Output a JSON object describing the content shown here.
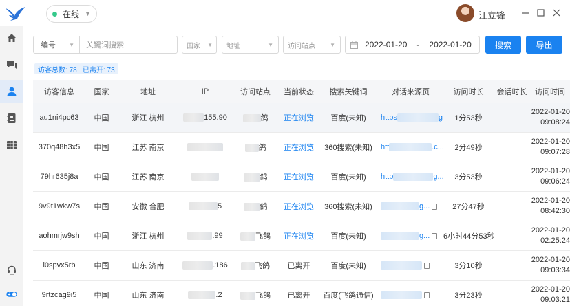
{
  "topbar": {
    "status_label": "在线",
    "user_name": "江立锋",
    "status_color": "#36c98b"
  },
  "sidebar": {
    "items": [
      {
        "icon": "home-icon",
        "active": false
      },
      {
        "icon": "chat-icon",
        "active": false
      },
      {
        "icon": "user-icon",
        "active": true
      },
      {
        "icon": "contacts-icon",
        "active": false
      },
      {
        "icon": "grid-icon",
        "active": false
      }
    ],
    "bottom": [
      {
        "icon": "support-icon"
      },
      {
        "icon": "toggle-icon"
      }
    ]
  },
  "filters": {
    "field_select": "编号",
    "keyword_placeholder": "关键词搜索",
    "country_placeholder": "国家",
    "address_placeholder": "地址",
    "site_placeholder": "访问站点",
    "date_start": "2022-01-20",
    "date_sep": "-",
    "date_end": "2022-01-20",
    "search_label": "搜索",
    "export_label": "导出"
  },
  "stats": {
    "total_visitors": "访客总数: 78",
    "left_count": "已离开: 73"
  },
  "table": {
    "headers": [
      "访客信息",
      "国家",
      "地址",
      "IP",
      "访问站点",
      "当前状态",
      "搜索关键词",
      "对话来源页",
      "访问时长",
      "会话时长",
      "访问时间"
    ],
    "rows": [
      {
        "id": "au1ni4pc63",
        "country": "中国",
        "address": "浙江 杭州",
        "ip": "155.90",
        "site": "鸽",
        "status": "正在浏览",
        "keyword": "百度(未知)",
        "source": "https",
        "source_end": "g...",
        "duration": "1分53秒",
        "session": "",
        "time": "2022-01-20 09:08:24"
      },
      {
        "id": "370q48h3x5",
        "country": "中国",
        "address": "江苏 南京",
        "ip": "",
        "site": "鸽",
        "status": "正在浏览",
        "keyword": "360搜索(未知)",
        "source": "htt",
        "source_end": ".c...",
        "duration": "2分49秒",
        "session": "",
        "time": "2022-01-20 09:07:28"
      },
      {
        "id": "79hr635j8a",
        "country": "中国",
        "address": "江苏 南京",
        "ip": "",
        "site": "鸽",
        "status": "正在浏览",
        "keyword": "百度(未知)",
        "source": "http",
        "source_end": "g...",
        "duration": "3分53秒",
        "session": "",
        "time": "2022-01-20 09:06:24"
      },
      {
        "id": "9v9t1wkw7s",
        "country": "中国",
        "address": "安徽 合肥",
        "ip": "5",
        "site": "鸽",
        "status": "正在浏览",
        "keyword": "360搜索(未知)",
        "source": "",
        "source_end": "g...",
        "duration": "27分47秒",
        "session": "",
        "time": "2022-01-20 08:42:30"
      },
      {
        "id": "aohmrjw9sh",
        "country": "中国",
        "address": "浙江 杭州",
        "ip": ".99",
        "site": "飞鸽",
        "status": "正在浏览",
        "keyword": "百度(未知)",
        "source": "",
        "source_end": "g...",
        "duration": "6小时44分53秒",
        "session": "",
        "time": "2022-01-20 02:25:24"
      },
      {
        "id": "i0spvx5rb",
        "country": "中国",
        "address": "山东 济南",
        "ip": ".186",
        "site": "飞鸽",
        "status": "已离开",
        "keyword": "百度(未知)",
        "source": "",
        "source_end": "",
        "duration": "3分10秒",
        "session": "",
        "time": "2022-01-20 09:03:34"
      },
      {
        "id": "9rtzcag9i5",
        "country": "中国",
        "address": "山东 济南",
        "ip": ".2",
        "site": "飞鸽",
        "status": "已离开",
        "keyword": "百度(飞鸽通信)",
        "source": "",
        "source_end": "",
        "duration": "3分23秒",
        "session": "",
        "time": "2022-01-20 09:03:21"
      }
    ]
  }
}
